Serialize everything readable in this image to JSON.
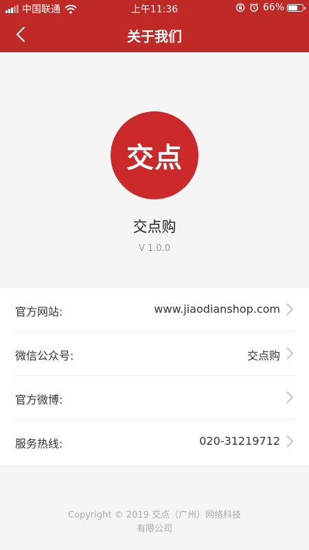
{
  "status_bar": {
    "carrier": "中国联通",
    "time": "上午11:36",
    "battery": "66%",
    "battery_level": 0.66
  },
  "nav": {
    "title": "关于我们"
  },
  "app": {
    "logo_text": "交点",
    "name": "交点购",
    "version": "V 1.0.0"
  },
  "info_rows": [
    {
      "label": "官方网站:",
      "value": "www.jiaodianshop.com"
    },
    {
      "label": "微信公众号:",
      "value": "交点购"
    },
    {
      "label": "官方微博:",
      "value": ""
    },
    {
      "label": "服务热线:",
      "value": "020-31219712"
    }
  ],
  "footer": {
    "line1": "Copyright © 2019 交点（广州）网络科技",
    "line2": "有限公司"
  },
  "colors": {
    "brand_red": "#bf2a27",
    "logo_red": "#cc2a2a"
  }
}
